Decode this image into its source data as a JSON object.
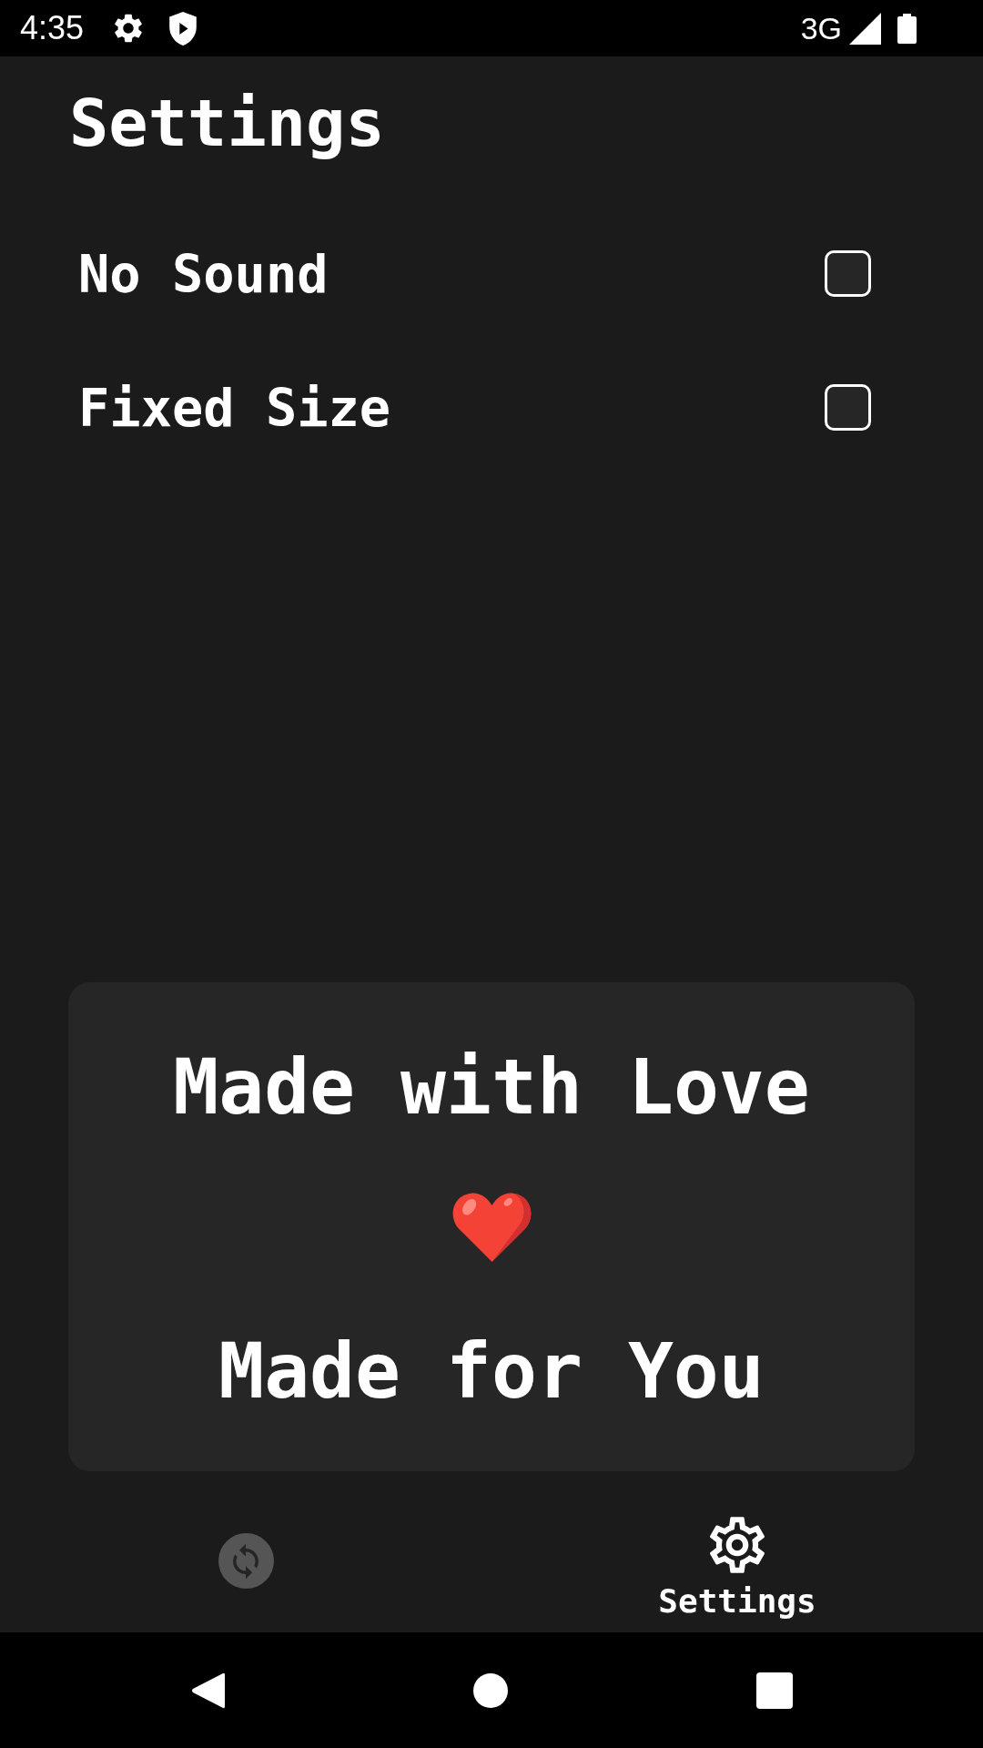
{
  "status_bar": {
    "time": "4:35",
    "network": "3G"
  },
  "title": "Settings",
  "settings": [
    {
      "label": "No Sound",
      "checked": false
    },
    {
      "label": "Fixed Size",
      "checked": false
    }
  ],
  "card": {
    "heading": "Made with Love",
    "subheading": "Made for You"
  },
  "bottom_nav": [
    {
      "kind": "sync",
      "selected": false
    },
    {
      "kind": "settings",
      "label": "Settings",
      "selected": true
    }
  ]
}
